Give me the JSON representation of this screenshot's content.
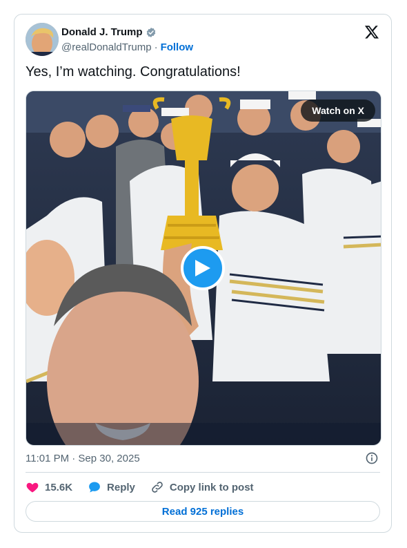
{
  "author": {
    "name": "Donald J. Trump",
    "handle": "@realDonaldTrump",
    "separator": "·",
    "follow_label": "Follow"
  },
  "tweet": {
    "text": "Yes, I’m watching. Congratulations!",
    "timestamp": "11:01 PM · Sep 30, 2025"
  },
  "media": {
    "watch_label": "Watch on X",
    "icon": "play-icon"
  },
  "actions": {
    "likes": "15.6K",
    "reply_label": "Reply",
    "copy_label": "Copy link to post"
  },
  "replies_button": "Read 925 replies",
  "colors": {
    "accent": "#1d9bf0",
    "link": "#006fd6",
    "like": "#f91880",
    "border": "#cfd9de",
    "muted": "#536471"
  }
}
